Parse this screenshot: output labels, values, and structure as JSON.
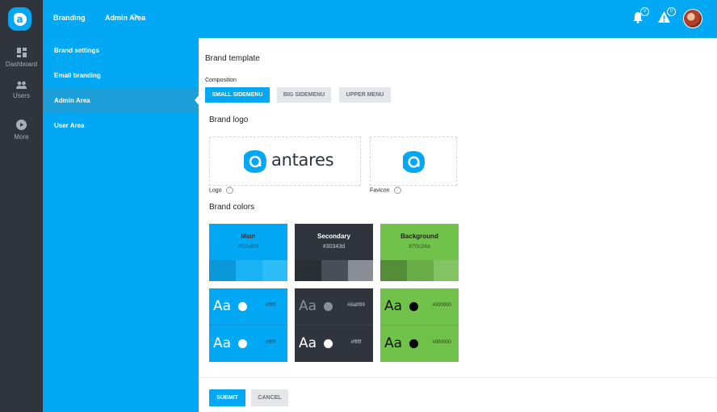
{
  "rail": {
    "items": [
      {
        "label": "Dashboard",
        "icon": "dashboard-icon"
      },
      {
        "label": "Users",
        "icon": "users-icon"
      },
      {
        "label": "More",
        "icon": "play-circle-icon"
      }
    ]
  },
  "topbar": {
    "breadcrumb": [
      "Branding",
      "Admin Area"
    ],
    "separator": ">",
    "notifications_count": "0",
    "alerts_count": "0"
  },
  "subnav": {
    "items": [
      {
        "label": "Brand settings"
      },
      {
        "label": "Email branding"
      },
      {
        "label": "Admin Area"
      },
      {
        "label": "User Area"
      }
    ]
  },
  "main": {
    "title": "Brand template",
    "composition_label": "Composition",
    "composition_options": [
      "SMALL SIDEMENU",
      "BIG SIDEMENU",
      "UPPER MENU"
    ],
    "logo_section_title": "Brand logo",
    "logo_text": "antares",
    "logo_label": "Logo",
    "favicon_label": "Favicon",
    "help_glyph": "?",
    "colors_section_title": "Brand colors",
    "colors": [
      {
        "name": "Main",
        "hex": "#02a8f3",
        "shades": [
          "#0a98d8",
          "#1ab4f6",
          "#2cbcf7"
        ]
      },
      {
        "name": "Secondary",
        "hex": "#30343d",
        "shades": [
          "#2a2e35",
          "#4a4e57",
          "#8a8e97"
        ]
      },
      {
        "name": "Background",
        "hex": "#70c24a",
        "shades": [
          "#548c38",
          "#6aae48",
          "#82c463"
        ]
      }
    ],
    "text_samples": [
      {
        "bg": "#02a8f3",
        "rows": [
          {
            "aa": "Aa",
            "color": "#ffffff",
            "hex": "#ffffff"
          },
          {
            "aa": "Aa",
            "color": "#ffffff",
            "hex": "#ffffff"
          }
        ]
      },
      {
        "bg": "#30343d",
        "rows": [
          {
            "aa": "Aa",
            "color": "#8a8f99",
            "hex": "#8a8f99"
          },
          {
            "aa": "Aa",
            "color": "#ffffff",
            "hex": "#ffffff"
          }
        ]
      },
      {
        "bg": "#70c24a",
        "rows": [
          {
            "aa": "Aa",
            "color": "#000000",
            "hex": "#000000"
          },
          {
            "aa": "Aa",
            "color": "#000000",
            "hex": "#000000"
          }
        ]
      }
    ],
    "submit_label": "SUBMIT",
    "cancel_label": "CANCEL"
  },
  "colors": {
    "accent": "#02a8f3",
    "rail_bg": "#30343d"
  }
}
